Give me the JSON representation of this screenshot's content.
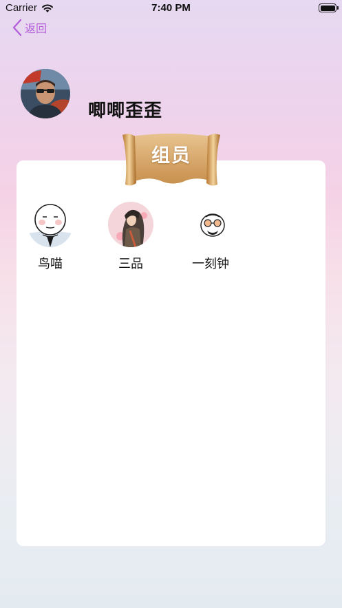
{
  "status_bar": {
    "carrier": "Carrier",
    "time": "7:40 PM"
  },
  "nav": {
    "back_label": "返回"
  },
  "profile": {
    "username": "唧唧歪歪"
  },
  "group": {
    "title": "组员",
    "members": [
      {
        "name": "鸟喵"
      },
      {
        "name": "三品"
      },
      {
        "name": "一刻钟"
      }
    ]
  },
  "colors": {
    "accent": "#b45fd8",
    "scroll": "#d9a867"
  }
}
